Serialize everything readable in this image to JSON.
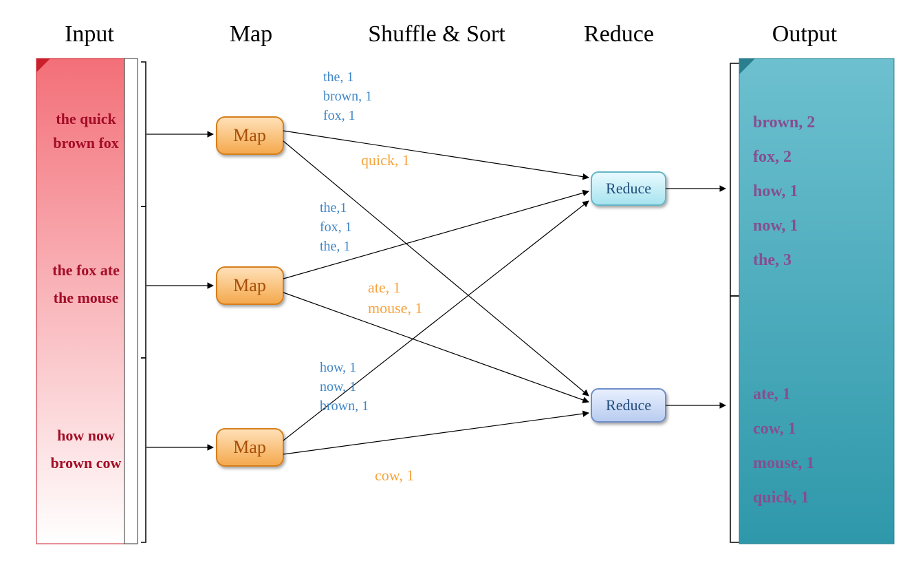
{
  "headers": {
    "input": "Input",
    "map": "Map",
    "shuffle": "Shuffle & Sort",
    "reduce": "Reduce",
    "output": "Output"
  },
  "input": {
    "chunk1": {
      "line1": "the quick",
      "line2": "brown fox"
    },
    "chunk2": {
      "line1": "the fox ate",
      "line2": "the mouse"
    },
    "chunk3": {
      "line1": "how now",
      "line2": "brown cow"
    }
  },
  "mapLabel": "Map",
  "reduceLabel": "Reduce",
  "kv": {
    "m1blue": {
      "a": "the, 1",
      "b": "brown, 1",
      "c": "fox, 1"
    },
    "m1orange": "quick, 1",
    "m2blue": {
      "a": "the,1",
      "b": "fox, 1",
      "c": "the, 1"
    },
    "m2orange": {
      "a": "ate, 1",
      "b": "mouse, 1"
    },
    "m3blue": {
      "a": "how, 1",
      "b": "now, 1",
      "c": "brown, 1"
    },
    "m3orange": "cow, 1"
  },
  "output": {
    "group1": {
      "a": "brown, 2",
      "b": "fox, 2",
      "c": "how, 1",
      "d": "now, 1",
      "e": "the, 3"
    },
    "group2": {
      "a": "ate, 1",
      "b": "cow, 1",
      "c": "mouse, 1",
      "d": "quick, 1"
    }
  }
}
